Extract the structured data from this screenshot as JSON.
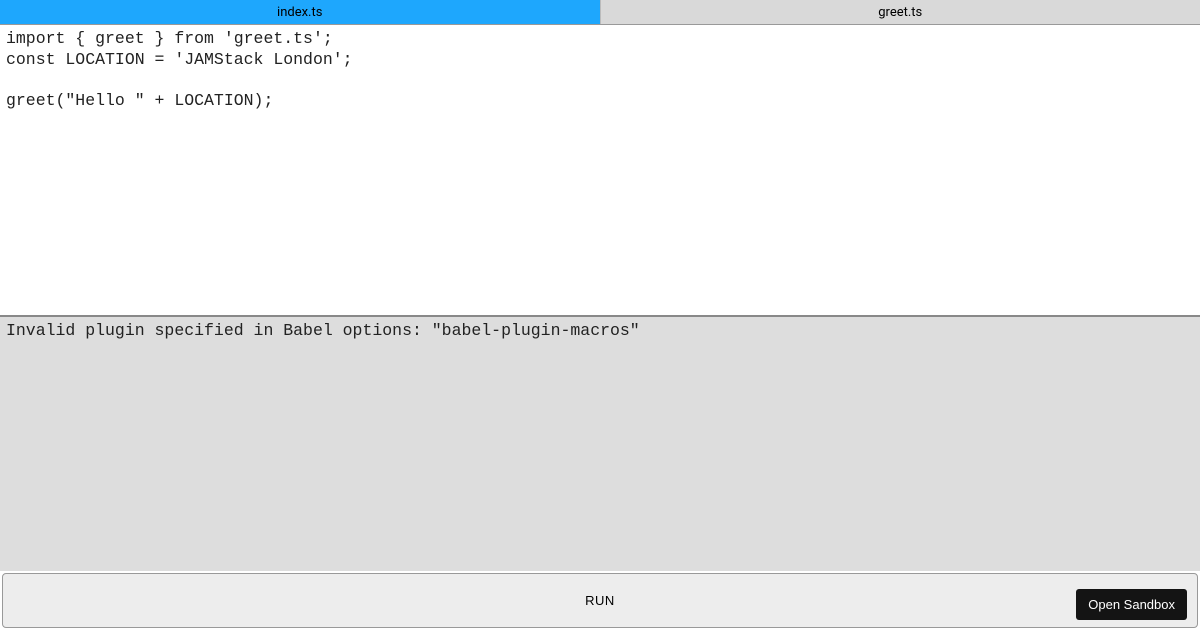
{
  "tabs": [
    {
      "label": "index.ts",
      "active": true
    },
    {
      "label": "greet.ts",
      "active": false
    }
  ],
  "editor": {
    "content": "import { greet } from 'greet.ts';\nconst LOCATION = 'JAMStack London';\n\ngreet(\"Hello \" + LOCATION);"
  },
  "output": {
    "content": "Invalid plugin specified in Babel options: \"babel-plugin-macros\""
  },
  "toolbar": {
    "run_label": "RUN",
    "open_sandbox_label": "Open Sandbox"
  }
}
